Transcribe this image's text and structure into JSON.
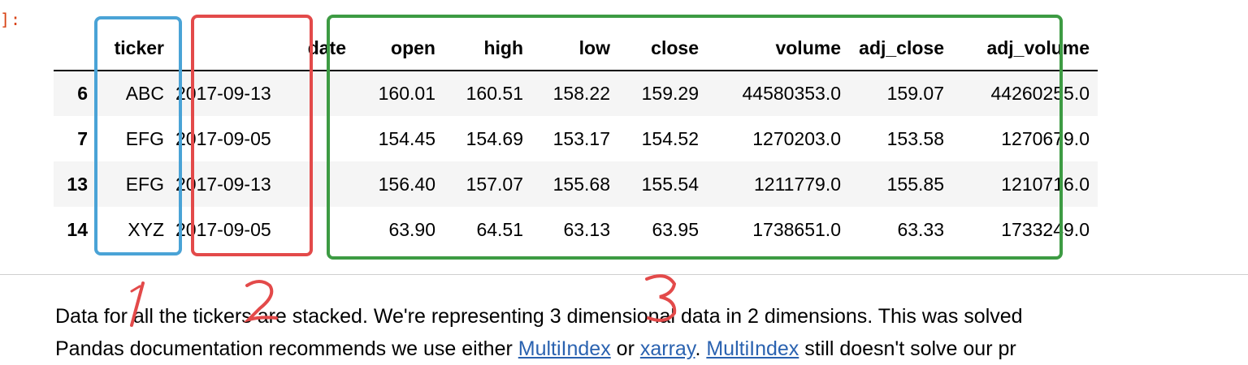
{
  "cell": {
    "prompt": "]:"
  },
  "table": {
    "headers": [
      "",
      "ticker",
      "date",
      "open",
      "high",
      "low",
      "close",
      "volume",
      "adj_close",
      "adj_volume"
    ],
    "rows": [
      [
        "6",
        "ABC",
        "2017-09-13",
        "160.01",
        "160.51",
        "158.22",
        "159.29",
        "44580353.0",
        "159.07",
        "44260255.0"
      ],
      [
        "7",
        "EFG",
        "2017-09-05",
        "154.45",
        "154.69",
        "153.17",
        "154.52",
        "1270203.0",
        "153.58",
        "1270679.0"
      ],
      [
        "13",
        "EFG",
        "2017-09-13",
        "156.40",
        "157.07",
        "155.68",
        "155.54",
        "1211779.0",
        "155.85",
        "1210716.0"
      ],
      [
        "14",
        "XYZ",
        "2017-09-05",
        "63.90",
        "64.51",
        "63.13",
        "63.95",
        "1738651.0",
        "63.33",
        "1733249.0"
      ]
    ]
  },
  "annotations": {
    "colors": {
      "blue": "#4aa3d6",
      "red": "#e34a4a",
      "green": "#3d9b43"
    },
    "numbers": [
      "1",
      "2",
      "3"
    ]
  },
  "paragraph": {
    "line1": "Data for all the tickers are stacked. We're representing 3 dimensional data in 2 dimensions. This was solved",
    "line2_prefix": "Pandas documentation recommends we use either ",
    "link_multiindex": "MultiIndex",
    "line2_or": " or ",
    "link_xarray": "xarray",
    "line2_sep": ". ",
    "link_multiindex2": "MultiIndex",
    "line2_suffix": " still doesn't solve our pr"
  }
}
